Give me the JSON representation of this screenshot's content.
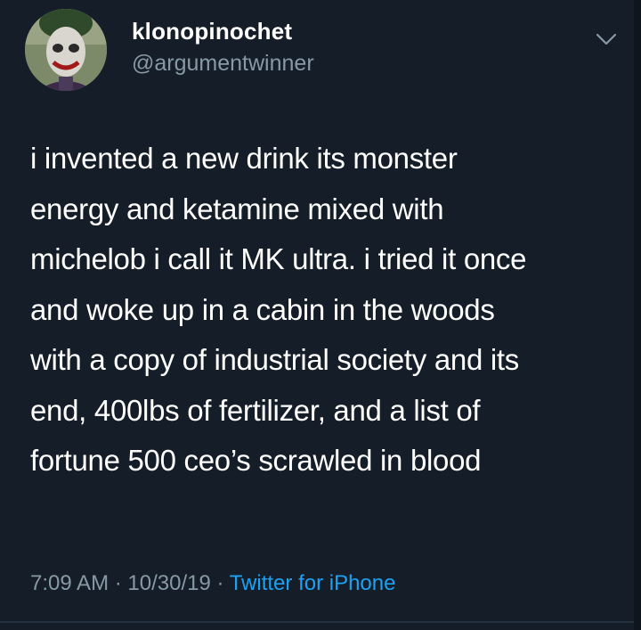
{
  "user": {
    "display_name": "klonopinochet",
    "handle": "@argumentwinner"
  },
  "tweet": {
    "lines": [
      "i invented a new drink its monster",
      "energy and ketamine mixed with",
      "michelob i call it MK ultra. i tried it once",
      "and woke  up in a cabin in the woods",
      "with a copy of industrial society and its",
      "end, 400lbs of fertilizer, and a list of",
      "fortune 500 ceo’s scrawled in blood"
    ]
  },
  "meta": {
    "time": "7:09 AM",
    "separator": " · ",
    "date": "10/30/19",
    "source": "Twitter for iPhone"
  },
  "icons": {
    "menu": "chevron-down-icon",
    "avatar": "profile-avatar"
  },
  "colors": {
    "background": "#151e28",
    "text": "#ffffff",
    "secondary": "#8899a6",
    "link": "#1da1f2"
  }
}
